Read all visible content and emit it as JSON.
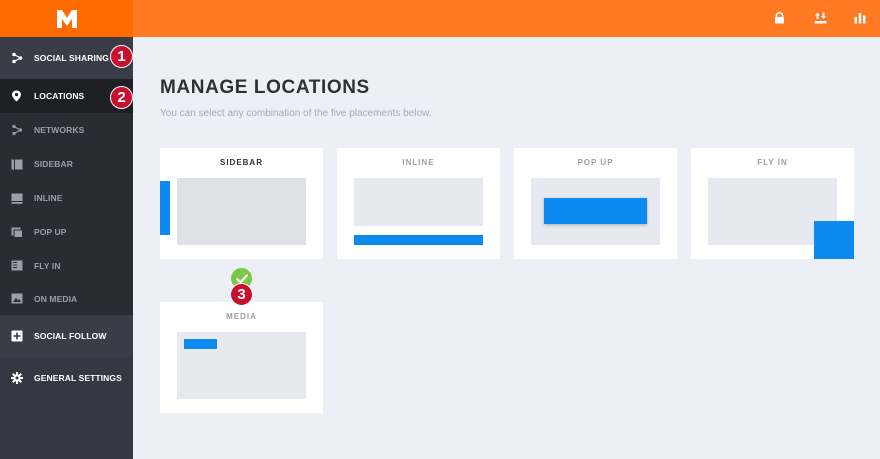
{
  "app": {
    "logo": "m-logo-icon",
    "header_icons": [
      "lock-icon",
      "import-export-icon",
      "stats-icon"
    ]
  },
  "sidebar": {
    "social_sharing": "SOCIAL SHARING",
    "locations": "LOCATIONS",
    "networks": "NETWORKS",
    "sidebar": "SIDEBAR",
    "inline": "INLINE",
    "pop_up": "POP UP",
    "fly_in": "FLY IN",
    "on_media": "ON MEDIA",
    "social_follow": "SOCIAL FOLLOW",
    "general_settings": "GENERAL SETTINGS"
  },
  "main": {
    "title": "MANAGE LOCATIONS",
    "subtitle": "You can select any combination of the five placements below.",
    "cards": {
      "sidebar": "SIDEBAR",
      "inline": "INLINE",
      "pop_up": "POP UP",
      "fly_in": "FLY IN",
      "media": "MEDIA"
    }
  },
  "annotations": {
    "badge1": "1",
    "badge2": "2",
    "badge3": "3"
  },
  "colors": {
    "accent": "#ff6b00",
    "header": "#ff7a23",
    "sidebar_bg": "#353742",
    "preview_blue": "#0c8af0",
    "check_green": "#7ac943",
    "badge_red": "#c8102e"
  }
}
